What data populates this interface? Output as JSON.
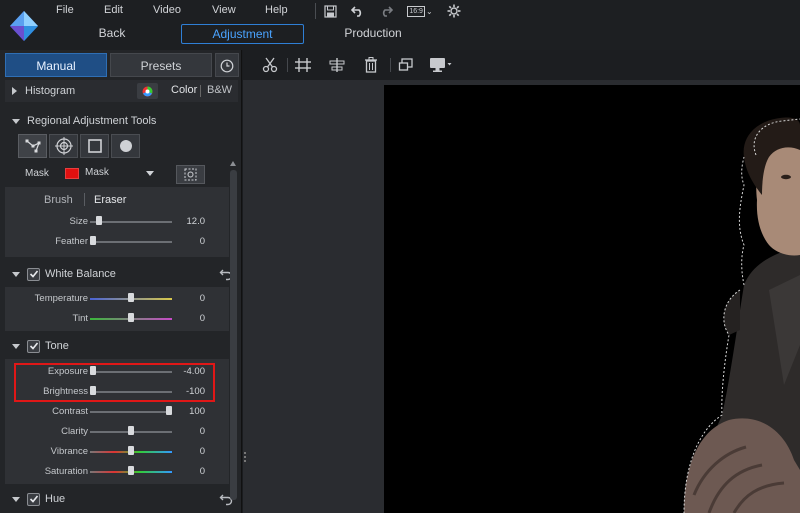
{
  "menu": [
    "File",
    "Edit",
    "Video",
    "View",
    "Help"
  ],
  "toolbar_icons": [
    "save-icon",
    "undo-icon",
    "redo-icon",
    "aspect-ratio-icon",
    "settings-icon"
  ],
  "aspect_label": "16:9",
  "modes": {
    "back": "Back",
    "adjustment": "Adjustment",
    "production": "Production"
  },
  "panel_tabs": {
    "manual": "Manual",
    "presets": "Presets"
  },
  "histogram": {
    "title": "Histogram",
    "color": "Color",
    "bw": "B&W"
  },
  "regional": {
    "title": "Regional Adjustment Tools"
  },
  "mask": {
    "label": "Mask",
    "dropdown": "Mask",
    "swatch_color": "#e01010"
  },
  "brush": {
    "brush": "Brush",
    "eraser": "Eraser"
  },
  "brush_sliders": [
    {
      "label": "Size",
      "value": "12.0",
      "pos": 0.08
    },
    {
      "label": "Feather",
      "value": "0",
      "pos": 0.0
    }
  ],
  "white_balance": {
    "title": "White Balance"
  },
  "wb_sliders": [
    {
      "label": "Temperature",
      "value": "0",
      "pos": 0.5
    },
    {
      "label": "Tint",
      "value": "0",
      "pos": 0.5
    }
  ],
  "tone": {
    "title": "Tone"
  },
  "tone_sliders": [
    {
      "label": "Exposure",
      "value": "-4.00",
      "pos": 0.0
    },
    {
      "label": "Brightness",
      "value": "-100",
      "pos": 0.0
    },
    {
      "label": "Contrast",
      "value": "100",
      "pos": 1.0
    },
    {
      "label": "Clarity",
      "value": "0",
      "pos": 0.5
    },
    {
      "label": "Vibrance",
      "value": "0",
      "pos": 0.5
    },
    {
      "label": "Saturation",
      "value": "0",
      "pos": 0.5
    }
  ],
  "hue": {
    "title": "Hue"
  },
  "colors": {
    "accent": "#2f7fd6",
    "highlight": "#e01717"
  }
}
